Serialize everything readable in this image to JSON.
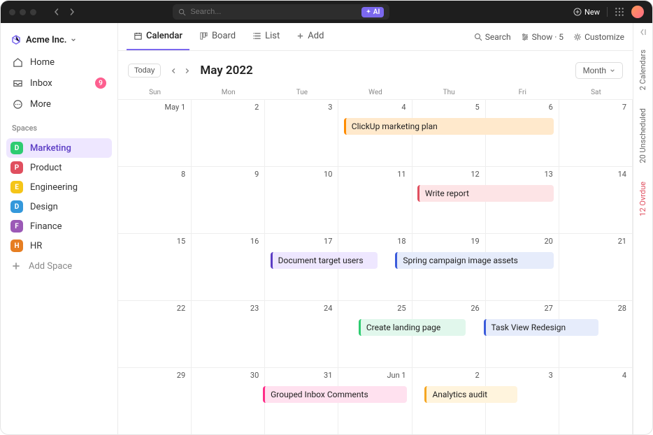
{
  "topbar": {
    "search_placeholder": "Search...",
    "ai_label": "AI",
    "new_label": "New"
  },
  "workspace": {
    "name": "Acme Inc."
  },
  "nav": {
    "home": "Home",
    "inbox": "Inbox",
    "inbox_count": "9",
    "more": "More"
  },
  "spaces_label": "Spaces",
  "spaces": [
    {
      "letter": "D",
      "name": "Marketing",
      "color": "#2ecc71",
      "active": true
    },
    {
      "letter": "P",
      "name": "Product",
      "color": "#e04f5f"
    },
    {
      "letter": "E",
      "name": "Engineering",
      "color": "#f5c518"
    },
    {
      "letter": "D",
      "name": "Design",
      "color": "#3498db"
    },
    {
      "letter": "F",
      "name": "Finance",
      "color": "#9b59b6"
    },
    {
      "letter": "H",
      "name": "HR",
      "color": "#e67e22"
    }
  ],
  "add_space": "Add Space",
  "tabs": {
    "calendar": "Calendar",
    "board": "Board",
    "list": "List",
    "add": "Add",
    "search": "Search",
    "show": "Show · 5",
    "customize": "Customize"
  },
  "cal": {
    "today": "Today",
    "title": "May 2022",
    "view": "Month",
    "dows": [
      "Sun",
      "Mon",
      "Tue",
      "Wed",
      "Thu",
      "Fri",
      "Sat"
    ],
    "weeks": [
      [
        "May 1",
        "2",
        "3",
        "4",
        "5",
        "6",
        "7"
      ],
      [
        "8",
        "9",
        "10",
        "11",
        "12",
        "13",
        "14"
      ],
      [
        "15",
        "16",
        "17",
        "18",
        "19",
        "20",
        "21"
      ],
      [
        "22",
        "23",
        "24",
        "25",
        "26",
        "27",
        "28"
      ],
      [
        "29",
        "30",
        "31",
        "Jun 1",
        "2",
        "3",
        "4"
      ]
    ],
    "events": [
      {
        "title": "ClickUp marketing plan",
        "week": 0,
        "start": 3,
        "span": 3,
        "color": "#ff8c00",
        "bg": "#ffe9cc"
      },
      {
        "title": "Write report",
        "week": 1,
        "start": 4,
        "span": 2,
        "color": "#e04f5f",
        "bg": "#fde4e6"
      },
      {
        "title": "Document target users",
        "week": 2,
        "start": 2,
        "span": 1.6,
        "color": "#5b3cc4",
        "bg": "#eee7ff"
      },
      {
        "title": "Spring campaign image assets",
        "week": 2,
        "start": 3.7,
        "span": 2.3,
        "color": "#3b5bdb",
        "bg": "#e6ecfb"
      },
      {
        "title": "Create landing page",
        "week": 3,
        "start": 3.2,
        "span": 1.6,
        "color": "#2ecc71",
        "bg": "#e1f7ec"
      },
      {
        "title": "Task View Redesign",
        "week": 3,
        "start": 4.9,
        "span": 1.7,
        "color": "#3b5bdb",
        "bg": "#e6ecfb"
      },
      {
        "title": "Grouped Inbox Comments",
        "week": 4,
        "start": 1.9,
        "span": 2.1,
        "color": "#ff2d88",
        "bg": "#ffe1ef"
      },
      {
        "title": "Analytics audit",
        "week": 4,
        "start": 4.1,
        "span": 1.4,
        "color": "#f5a623",
        "bg": "#fff4dd"
      }
    ]
  },
  "rail": {
    "calendars": "2 Calendars",
    "unscheduled": "20 Unscheduled",
    "overdue": "12 Ovrdue"
  }
}
